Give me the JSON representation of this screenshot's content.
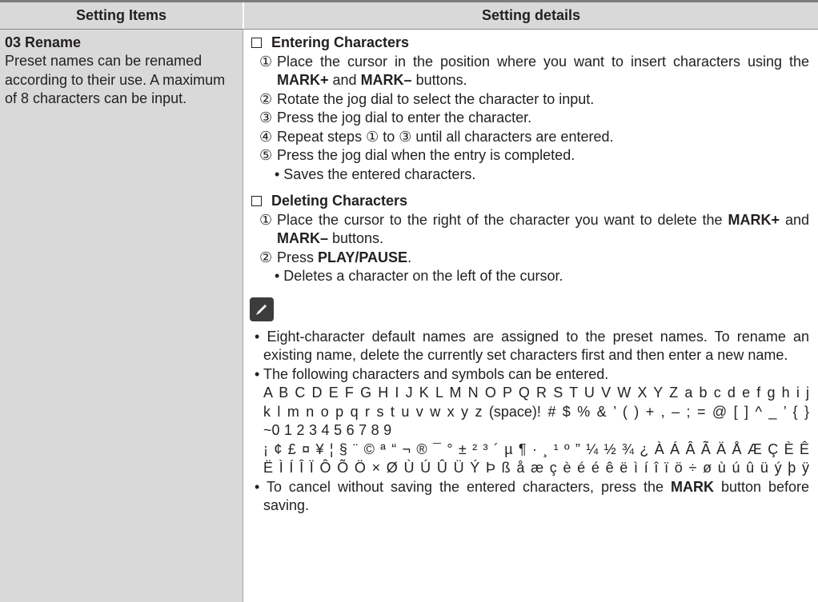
{
  "header": {
    "col1": "Setting Items",
    "col2": "Setting details"
  },
  "item": {
    "title": "03 Rename",
    "description": "Preset names can be renamed according to their use. A maximum of 8 characters can be input."
  },
  "entering": {
    "title": "Entering Characters",
    "step1_num": "①",
    "step1_a": "Place the cursor in the position where you want to insert characters using the ",
    "step1_b1": "MARK+",
    "step1_c": " and ",
    "step1_b2": "MARK–",
    "step1_d": " buttons.",
    "step2_num": "②",
    "step2": "Rotate the jog dial to select the character to input.",
    "step3_num": "③",
    "step3": "Press the jog dial to enter the character.",
    "step4_num": "④",
    "step4": "Repeat steps ① to ③ until all characters are entered.",
    "step5_num": "⑤",
    "step5": "Press the jog dial when the entry is completed.",
    "bullet": "• Saves the entered characters."
  },
  "deleting": {
    "title": "Deleting Characters",
    "step1_num": "①",
    "step1_a": "Place the cursor to the right of the character you want to delete the ",
    "step1_b1": "MARK+",
    "step1_c": " and ",
    "step1_b2": "MARK–",
    "step1_d": " buttons.",
    "step2_num": "②",
    "step2_a": "Press ",
    "step2_b": "PLAY/PAUSE",
    "step2_c": ".",
    "bullet": "• Deletes a character on the left of the cursor."
  },
  "note_icon": "pencil-icon",
  "notes": {
    "n1": "• Eight-character default names are assigned to the preset names. To rename an existing name, delete the currently set characters first and then enter a new name.",
    "n2": "• The following characters and symbols can be entered.",
    "chars1": "A B C D E F G H I J K L M N O P Q R S T U V W X Y Z a b c d e f g h i j",
    "chars2": "k l m n o p q r s t u v w x y z (space)! # $ % & ’ ( ) + , – ; = @ [ ] ^ _ ’ { }",
    "chars3": "~0 1 2 3 4 5 6 7 8 9",
    "chars4": "¡ ¢ £ ¤ ¥ ¦ § ¨ © ª “ ¬ ® ¯ ° ± ² ³ ´ µ ¶ · ¸ ¹ º ” ¼ ½ ¾ ¿ À Á Â Ã Ä Å Æ Ç È Ê",
    "chars5": "Ë Ì Í Î Ï Ô Õ Ö × Ø Ù Ú Û Ü Ý Þ ß å æ ç è é é ê ë ì í î ï ö ÷ ø ù ú û ü ý þ ÿ",
    "n3_a": "• To cancel without saving the entered characters, press the ",
    "n3_b": "MARK",
    "n3_c": " button before saving."
  }
}
